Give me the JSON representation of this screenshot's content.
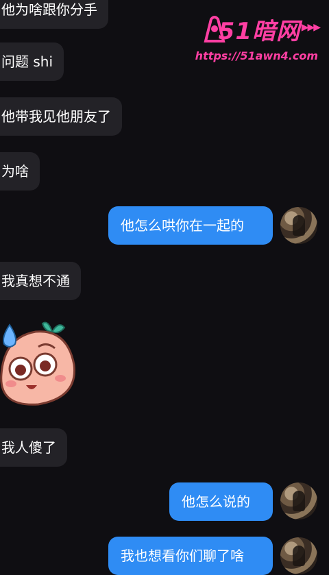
{
  "watermark": {
    "brand": "51暗网",
    "url": "https://51awn4.com",
    "arrows": "▶▶▶"
  },
  "messages": [
    {
      "side": "left",
      "text": "他为啥跟你分手"
    },
    {
      "side": "left",
      "text": "问题 shi"
    },
    {
      "side": "left",
      "text": "他带我见他朋友了"
    },
    {
      "side": "left",
      "text": "为啥"
    },
    {
      "side": "right",
      "text": "他怎么哄你在一起的"
    },
    {
      "side": "left",
      "text": "我真想不通"
    },
    {
      "side": "left",
      "sticker": "sweating-blob-sticker"
    },
    {
      "side": "left",
      "text": "我人傻了"
    },
    {
      "side": "right",
      "text": "他怎么说的"
    },
    {
      "side": "right",
      "text": "我也想看你们聊了啥"
    }
  ],
  "colors": {
    "background": "#0f0e12",
    "incoming_bubble": "#232227",
    "outgoing_bubble": "#2f8cf4",
    "watermark": "#ff3fa3"
  }
}
